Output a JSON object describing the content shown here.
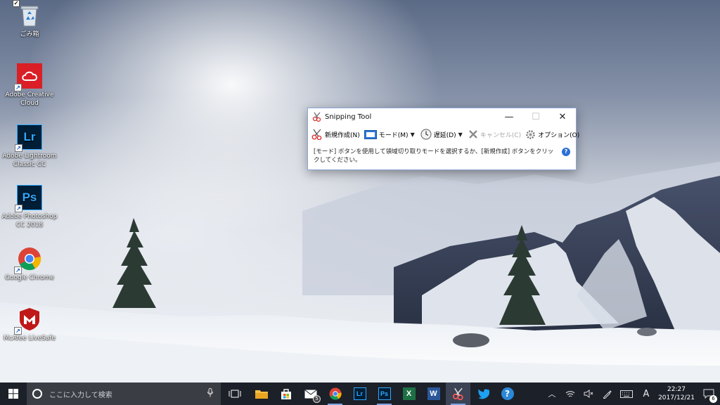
{
  "desktop": {
    "icons": [
      {
        "label": "ごみ箱",
        "icon": "recycle-bin-icon"
      },
      {
        "label": "Adobe Creative Cloud",
        "icon": "creative-cloud-icon"
      },
      {
        "label": "Adobe Lightroom Classic CC",
        "icon": "lightroom-icon",
        "glyph": "Lr"
      },
      {
        "label": "Adobe Photoshop CC 2018",
        "icon": "photoshop-icon",
        "glyph": "Ps"
      },
      {
        "label": "Google Chrome",
        "icon": "chrome-icon"
      },
      {
        "label": "McAfee LiveSafe",
        "icon": "mcafee-icon"
      }
    ]
  },
  "snipping_tool": {
    "title": "Snipping Tool",
    "toolbar": {
      "new_label": "新規作成(N)",
      "mode_label": "モード(M)",
      "delay_label": "遅延(D)",
      "cancel_label": "キャンセル(C)",
      "options_label": "オプション(O)"
    },
    "hint": "[モード] ボタンを使用して領域切り取りモードを選択するか、[新規作成] ボタンをクリックしてください。",
    "help_glyph": "?"
  },
  "taskbar": {
    "search_placeholder": "ここに入力して検索",
    "mail_badge": "5",
    "excel_glyph": "X",
    "word_glyph": "W",
    "lr_glyph": "Lr",
    "ps_glyph": "Ps",
    "ime_label": "A",
    "time": "22:27",
    "date": "2017/12/21",
    "notification_count": "6"
  },
  "colors": {
    "taskbar": "#1c2029",
    "accent": "#2b6fd6",
    "lr": "#31a8ff",
    "ps": "#31a8ff",
    "adobe_red": "#da1f26"
  }
}
